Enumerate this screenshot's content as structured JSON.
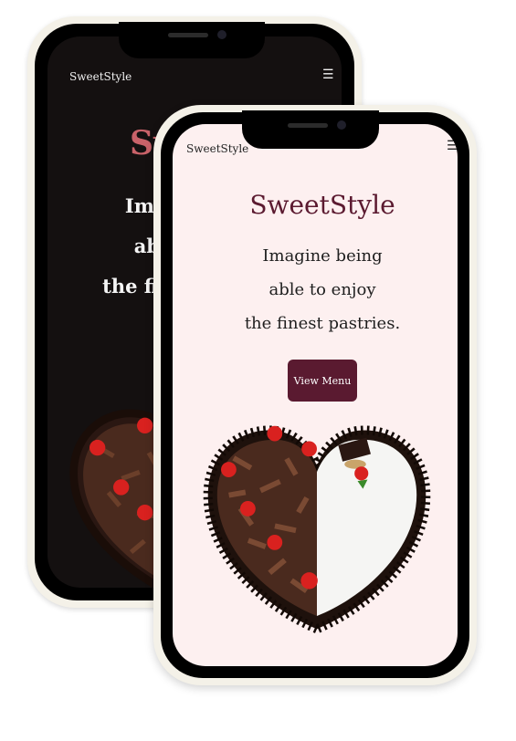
{
  "brand_name": "SweetStyle",
  "menu_icon": "hamburger-menu-icon",
  "hero": {
    "title": "SweetStyle",
    "tagline_lines": [
      "Imagine being",
      "able to enjoy",
      "the finest pastries."
    ],
    "button_label": "View Menu"
  },
  "colors": {
    "accent": "#5a1a30",
    "light_bg": "#fdf0f0",
    "dark_bg": "#141010",
    "dark_title": "#c96269"
  },
  "cake_image": "heart-shaped-black-forest-cake"
}
